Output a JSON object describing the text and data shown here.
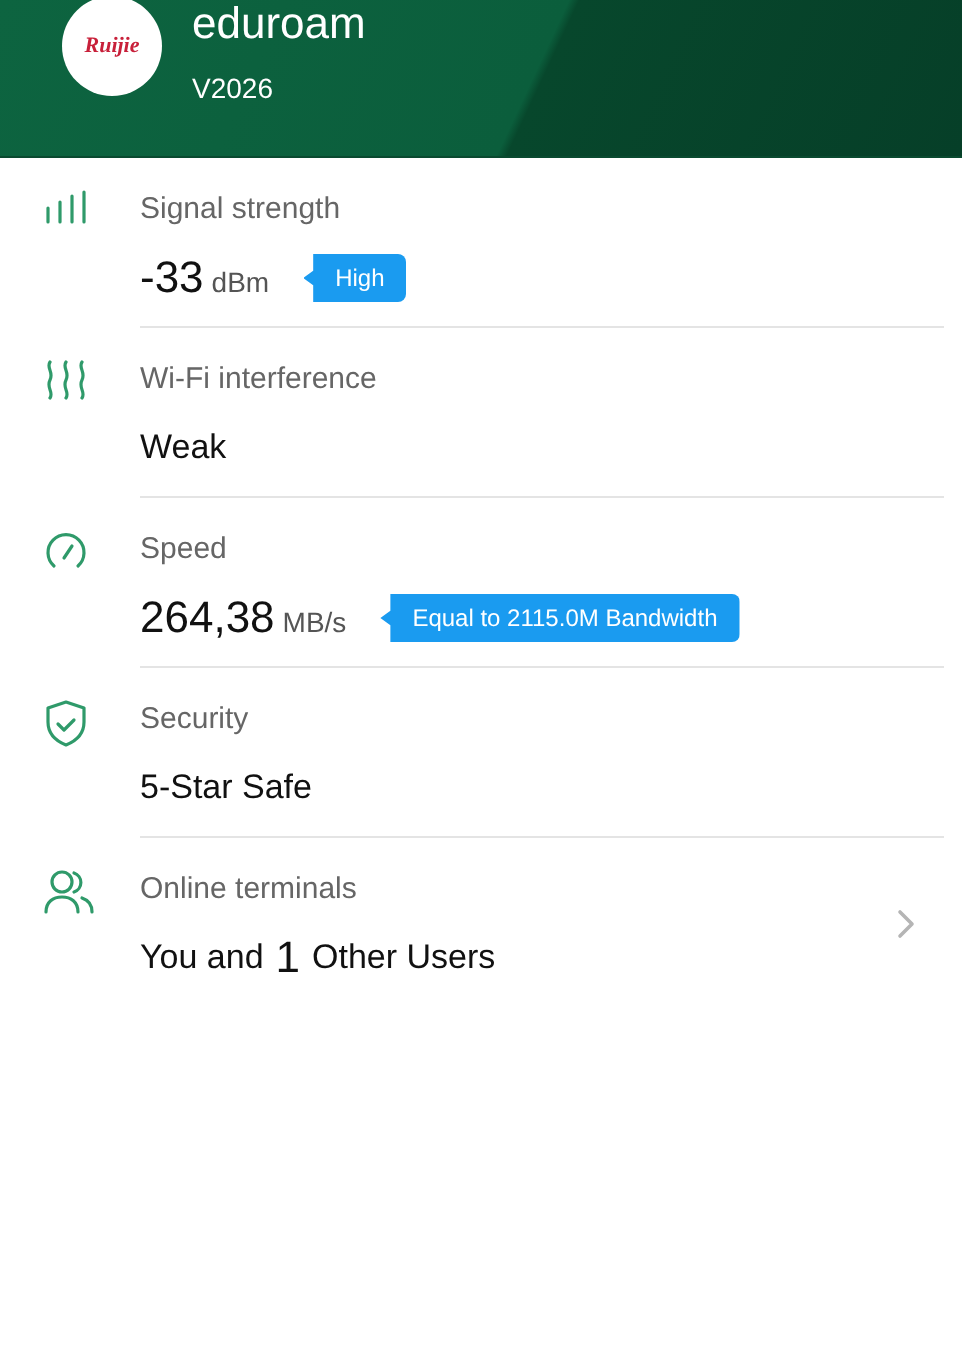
{
  "header": {
    "logo_text": "Ruijie",
    "title": "eduroam",
    "subtitle": "V2026"
  },
  "items": [
    {
      "kind": "signal",
      "label": "Signal strength",
      "value": "-33",
      "unit": "dBm",
      "badge": "High",
      "navigable": false
    },
    {
      "kind": "waves",
      "label": "Wi-Fi interference",
      "value": "Weak",
      "navigable": false
    },
    {
      "kind": "gauge",
      "label": "Speed",
      "value": "264,38",
      "unit": "MB/s",
      "badge": "Equal to 2115.0M Bandwidth",
      "navigable": false
    },
    {
      "kind": "shield",
      "label": "Security",
      "value": "5-Star Safe",
      "navigable": false
    },
    {
      "kind": "users",
      "label": "Online terminals",
      "prefix": "You and",
      "value": "1",
      "suffix": "Other Users",
      "navigable": true
    }
  ]
}
